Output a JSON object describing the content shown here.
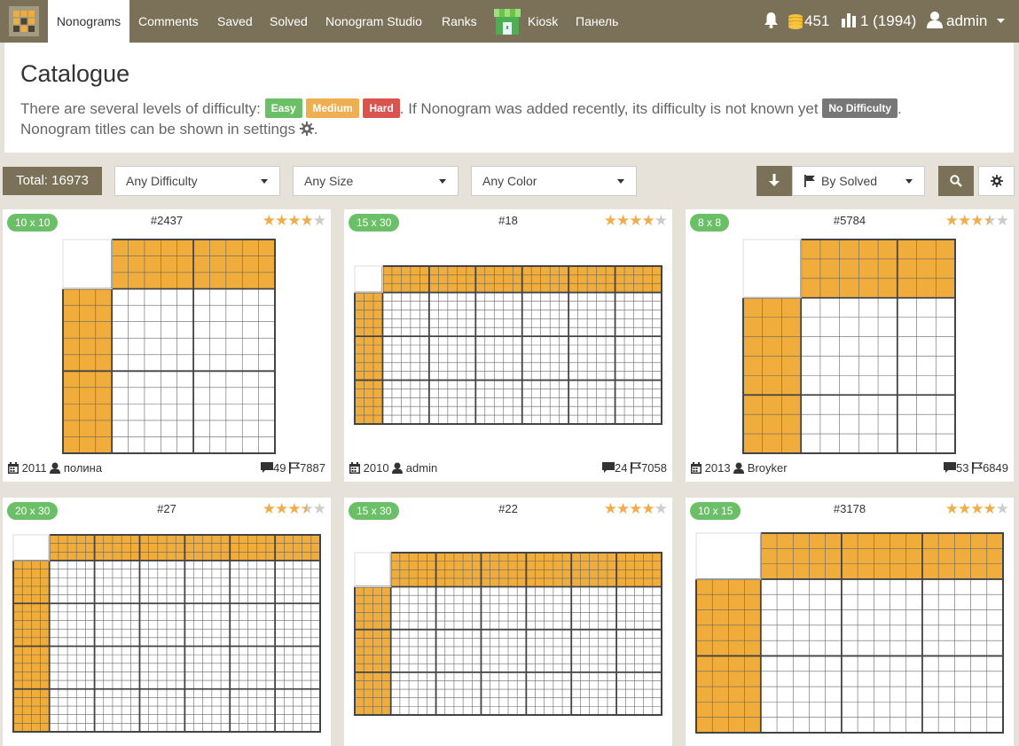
{
  "nav": {
    "items": [
      "Nonograms",
      "Comments",
      "Saved",
      "Solved",
      "Nonogram Studio",
      "Ranks",
      "Kiosk",
      "Панель"
    ],
    "coins": "451",
    "rank": "1 (1994)",
    "user": "admin"
  },
  "catalogue": {
    "title": "Catalogue",
    "line1_pre": "There are several levels of difficulty:",
    "easy": "Easy",
    "medium": "Medium",
    "hard": "Hard",
    "line1_post": ". If Nonogram was added recently, its difficulty is not known yet",
    "no_difficulty": "No Difficulty",
    "line1_end": ".",
    "line2": "Nonogram titles can be shown in settings",
    "line2_end": "."
  },
  "filters": {
    "total": "Total: 16973",
    "difficulty": "Any Difficulty",
    "size": "Any Size",
    "color": "Any Color",
    "sort": "By Solved"
  },
  "colors": {
    "nav": "#7b7158",
    "filled": "#f0ad3c",
    "easy": "#6bbf67",
    "medium": "#efaf50",
    "hard": "#d9534f"
  },
  "cards": [
    {
      "size": "10 x 10",
      "id": "#2437",
      "rating": 4.0,
      "year": "2011",
      "author": "полина",
      "comments": "49",
      "solved": "7887",
      "cols": 10,
      "rows": 10,
      "col_clue_rows": 3,
      "row_clue_cols": 3
    },
    {
      "size": "15 x 30",
      "id": "#18",
      "rating": 4.0,
      "year": "2010",
      "author": "admin",
      "comments": "24",
      "solved": "7058",
      "cols": 30,
      "rows": 15,
      "col_clue_rows": 3,
      "row_clue_cols": 3
    },
    {
      "size": "8 x 8",
      "id": "#5784",
      "rating": 3.5,
      "year": "2013",
      "author": "Broyker",
      "comments": "53",
      "solved": "6849",
      "cols": 8,
      "rows": 8,
      "col_clue_rows": 3,
      "row_clue_cols": 3
    },
    {
      "size": "20 x 30",
      "id": "#27",
      "rating": 3.5,
      "year": "",
      "author": "",
      "comments": "",
      "solved": "",
      "cols": 30,
      "rows": 20,
      "col_clue_rows": 3,
      "row_clue_cols": 4
    },
    {
      "size": "15 x 30",
      "id": "#22",
      "rating": 4.0,
      "year": "",
      "author": "",
      "comments": "",
      "solved": "",
      "cols": 30,
      "rows": 15,
      "col_clue_rows": 4,
      "row_clue_cols": 4
    },
    {
      "size": "10 x 15",
      "id": "#3178",
      "rating": 4.0,
      "year": "",
      "author": "",
      "comments": "",
      "solved": "",
      "cols": 15,
      "rows": 10,
      "col_clue_rows": 3,
      "row_clue_cols": 4
    }
  ]
}
